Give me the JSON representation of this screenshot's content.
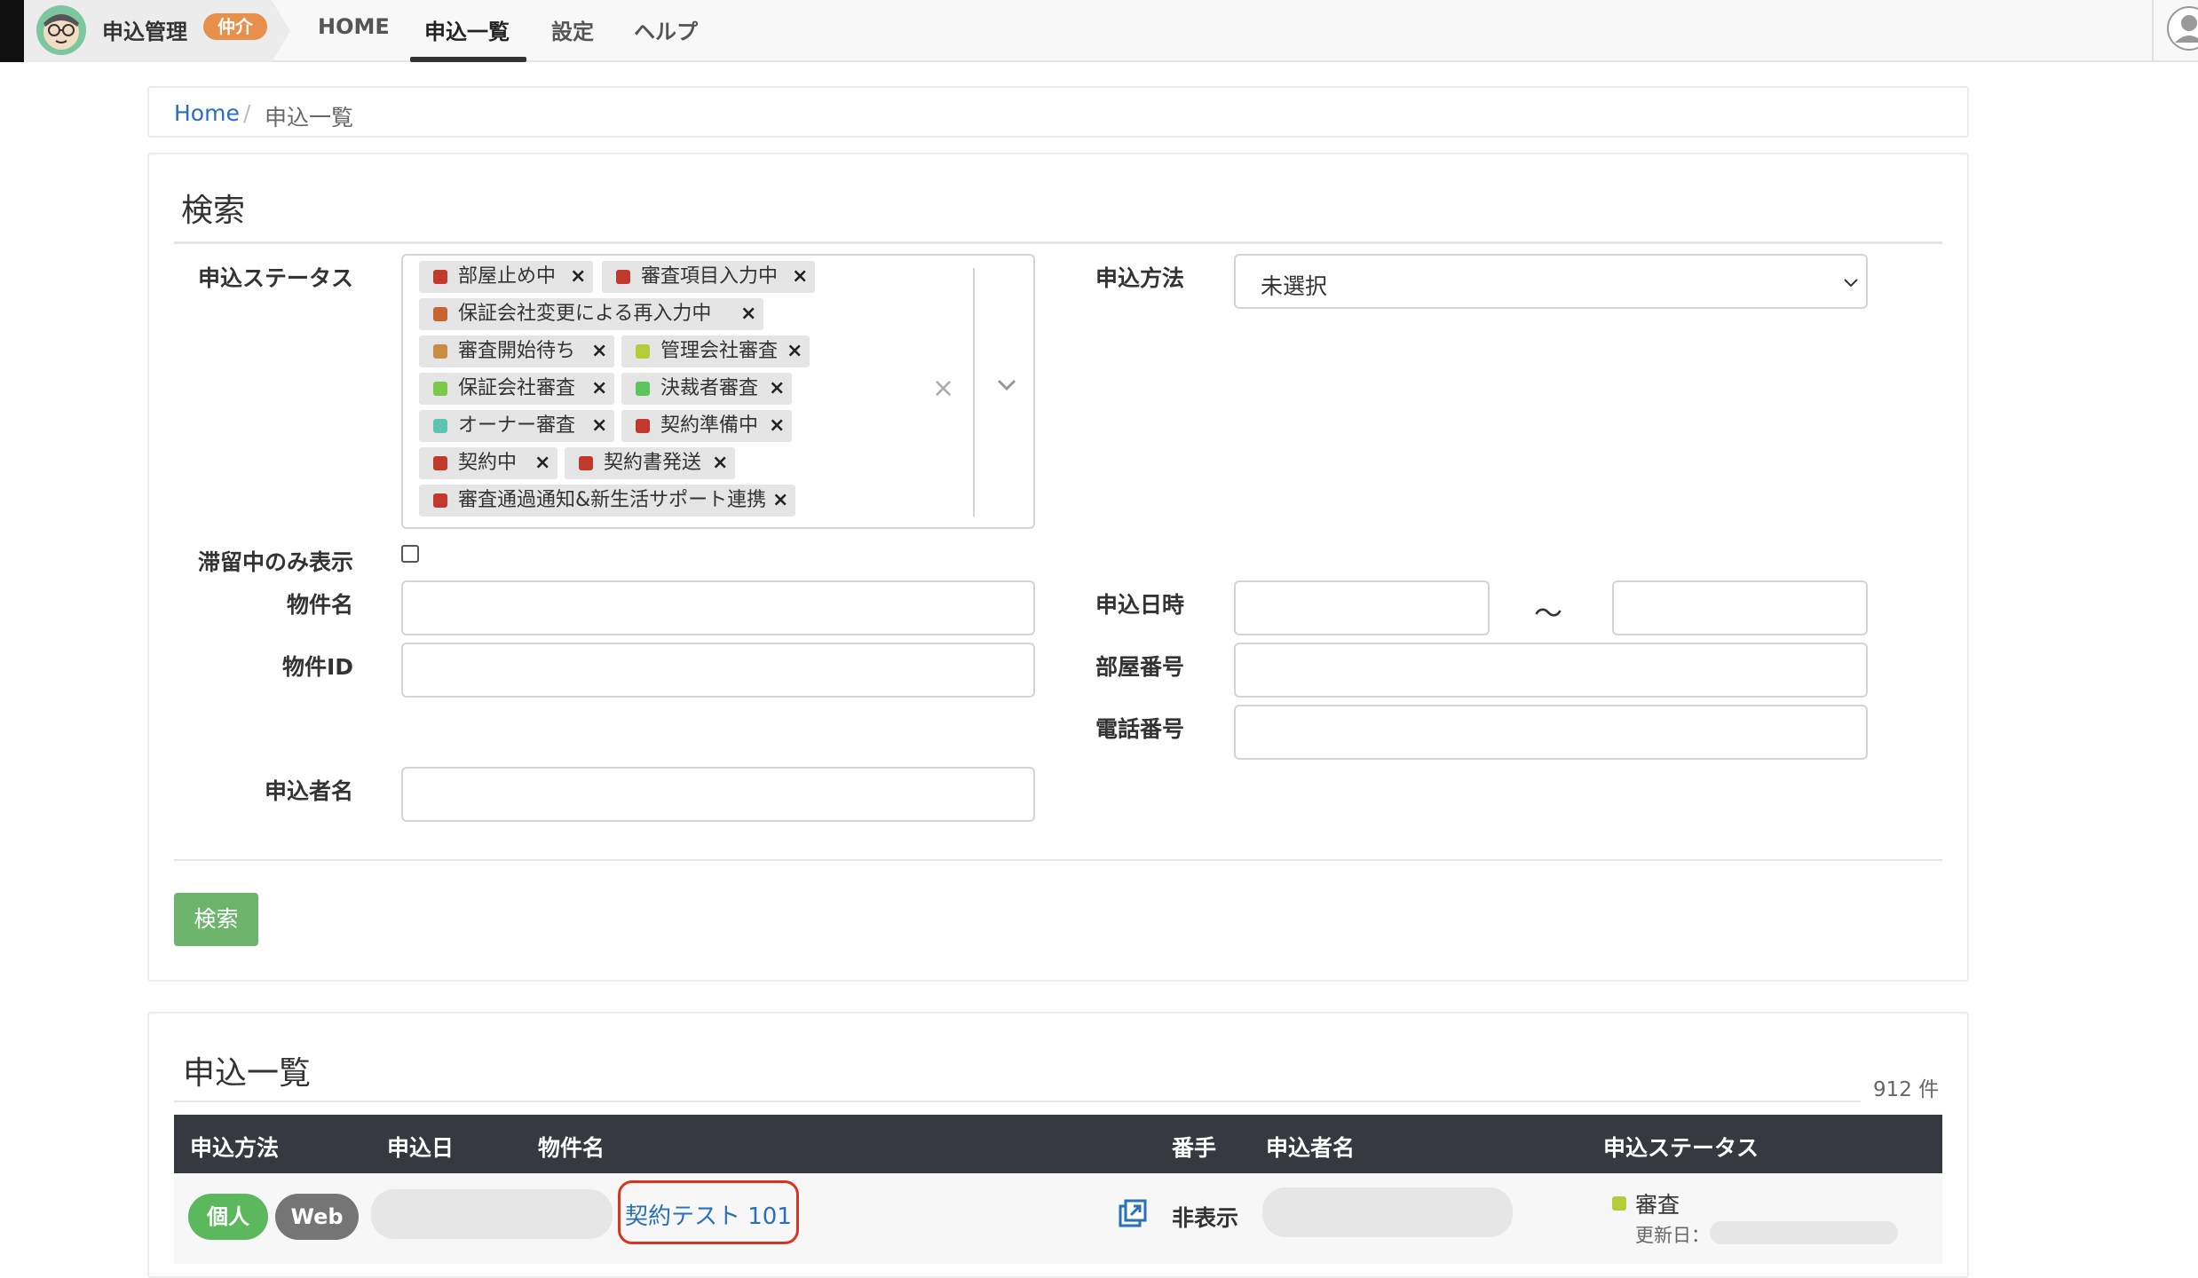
{
  "nav": {
    "brand_title": "申込管理",
    "brand_badge": "仲介",
    "links": [
      "HOME",
      "申込一覧",
      "設定",
      "ヘルプ"
    ],
    "active": "申込一覧"
  },
  "breadcrumb": {
    "home": "Home",
    "separator": "/",
    "current": "申込一覧"
  },
  "search": {
    "title": "検索",
    "status_label": "申込ステータス",
    "status_chips": [
      {
        "label": "部屋止め中",
        "color": "#c0392b"
      },
      {
        "label": "審査項目入力中",
        "color": "#c0392b"
      },
      {
        "label": "保証会社変更による再入力中",
        "color": "#c86432"
      },
      {
        "label": "審査開始待ち",
        "color": "#c88c46"
      },
      {
        "label": "管理会社審査",
        "color": "#b5cc3b"
      },
      {
        "label": "保証会社審査",
        "color": "#79c84a"
      },
      {
        "label": "決裁者審査",
        "color": "#5cc45c"
      },
      {
        "label": "オーナー審査",
        "color": "#5cc4b0"
      },
      {
        "label": "契約準備中",
        "color": "#c0392b"
      },
      {
        "label": "契約中",
        "color": "#c0392b"
      },
      {
        "label": "契約書発送",
        "color": "#c0392b"
      },
      {
        "label": "審査通過通知&新生活サポート連携",
        "color": "#c0392b"
      }
    ],
    "chip_remove": "×",
    "clear_all": "×",
    "method_label": "申込方法",
    "method_value": "未選択",
    "stagnant_label": "滞留中のみ表示",
    "property_name_label": "物件名",
    "property_id_label": "物件ID",
    "applicant_label": "申込者名",
    "date_label": "申込日時",
    "date_separator": "～",
    "room_label": "部屋番号",
    "phone_label": "電話番号",
    "search_button": "検索"
  },
  "list": {
    "title": "申込一覧",
    "count": "912 件",
    "columns": [
      "申込方法",
      "申込日",
      "物件名",
      "番手",
      "申込者名",
      "申込ステータス"
    ],
    "rows": [
      {
        "method_tags": [
          "個人",
          "Web"
        ],
        "property_name": "契約テスト 101",
        "rank": "非表示",
        "status": "審査",
        "updated_label": "更新日："
      }
    ]
  },
  "colors": {
    "tag_individual": "#5cb85c",
    "tag_web": "#757575",
    "search_button": "#6db56d",
    "brand_badge": "#e8904a",
    "link": "#2a6fba",
    "highlight": "#d9341f"
  }
}
